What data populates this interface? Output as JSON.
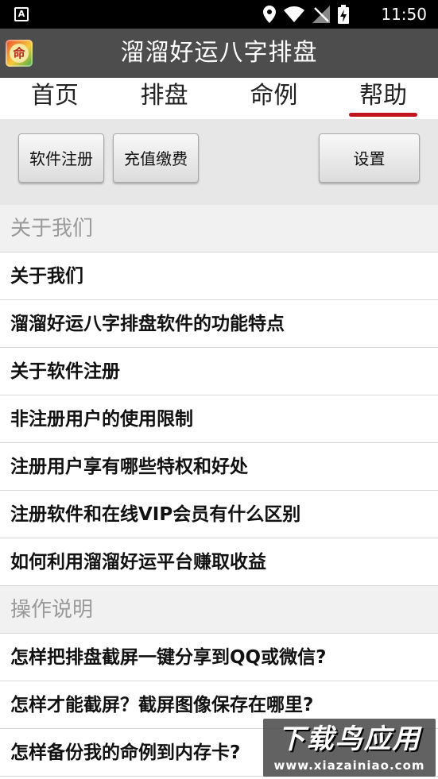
{
  "status_bar": {
    "app_badge": "A",
    "time": "11:50"
  },
  "header": {
    "logo_glyph": "命",
    "title": "溜溜好运八字排盘"
  },
  "tabs": [
    {
      "label": "首页",
      "active": false
    },
    {
      "label": "排盘",
      "active": false
    },
    {
      "label": "命例",
      "active": false
    },
    {
      "label": "帮助",
      "active": true
    }
  ],
  "toolbar": {
    "register_label": "软件注册",
    "recharge_label": "充值缴费",
    "settings_label": "设置"
  },
  "sections": [
    {
      "header": "关于我们",
      "items": [
        "关于我们",
        "溜溜好运八字排盘软件的功能特点",
        "关于软件注册",
        "非注册用户的使用限制",
        "注册用户享有哪些特权和好处",
        "注册软件和在线VIP会员有什么区别",
        "如何利用溜溜好运平台赚取收益"
      ]
    },
    {
      "header": "操作说明",
      "items": [
        "怎样把排盘截屏一键分享到QQ或微信?",
        "怎样才能截屏？截屏图像保存在哪里?",
        "怎样备份我的命例到内存卡?"
      ]
    }
  ],
  "watermark": {
    "main": "下载鸟应用",
    "url": "www.xiazainiao.com"
  },
  "colors": {
    "title_bar": "#4d4d4d",
    "active_tab_indicator": "#c0161e",
    "toolbar_bg": "#e7e7e7"
  }
}
